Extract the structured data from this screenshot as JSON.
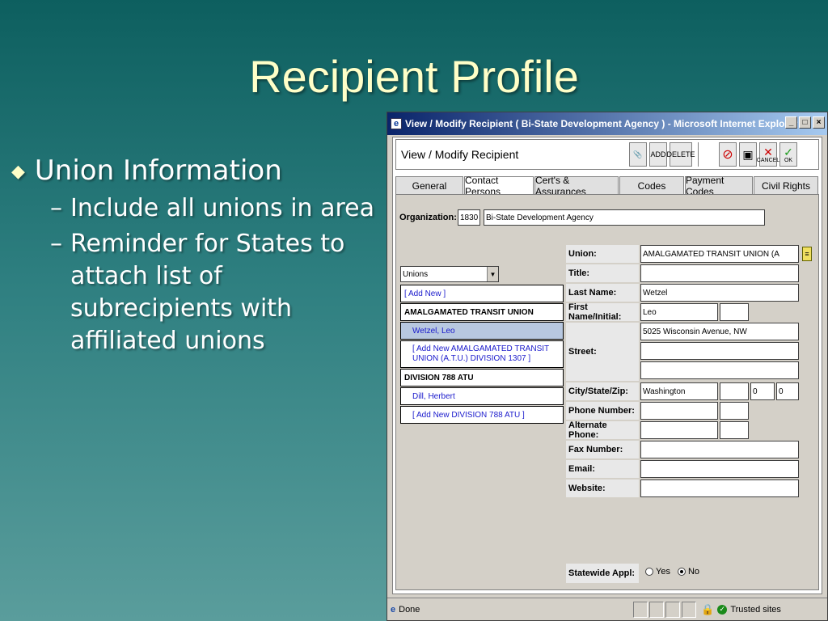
{
  "slide": {
    "title": "Recipient Profile",
    "bullet_main": "Union Information",
    "sub_bullets": [
      "Include all unions in area",
      "Reminder for States to attach list of subrecipients with affiliated unions"
    ]
  },
  "window": {
    "title": "View / Modify Recipient ( Bi-State Development Agency ) - Microsoft Internet Explorer",
    "page_title": "View / Modify Recipient",
    "btn_add": "ADD",
    "btn_delete": "DELETE",
    "btn_cancel": "CANCEL",
    "btn_ok": "OK"
  },
  "tabs": [
    "General",
    "Contact Persons",
    "Cert's & Assurances",
    "Codes",
    "Payment Codes",
    "Civil Rights"
  ],
  "org": {
    "label": "Organization:",
    "id": "1830",
    "name": "Bi-State Development Agency"
  },
  "dropdown": {
    "value": "Unions"
  },
  "unions": [
    {
      "text": "[ Add New ]"
    },
    {
      "text": "AMALGAMATED TRANSIT UNION"
    },
    {
      "text": "Wetzel, Leo"
    },
    {
      "text": "[ Add New AMALGAMATED TRANSIT UNION (A.T.U.) DIVISION 1307 ]"
    },
    {
      "text": "DIVISION 788 ATU"
    },
    {
      "text": "Dill, Herbert"
    },
    {
      "text": "[ Add New DIVISION 788 ATU ]"
    }
  ],
  "form": {
    "union_label": "Union:",
    "union_value": "AMALGAMATED TRANSIT UNION (A",
    "title_label": "Title:",
    "lastname_label": "Last Name:",
    "lastname_value": "Wetzel",
    "firstname_label": "First Name/Initial:",
    "firstname_value": "Leo",
    "street_label": "Street:",
    "street_value": "5025 Wisconsin Avenue, NW",
    "city_label": "City/State/Zip:",
    "city_value": "Washington",
    "zip1": "0",
    "zip2": "0",
    "phone_label": "Phone Number:",
    "altphone_label": "Alternate Phone:",
    "fax_label": "Fax Number:",
    "email_label": "Email:",
    "website_label": "Website:",
    "statewide_label": "Statewide Appl:",
    "opt_yes": "Yes",
    "opt_no": "No"
  },
  "status": {
    "text": "Done",
    "zone": "Trusted sites"
  }
}
